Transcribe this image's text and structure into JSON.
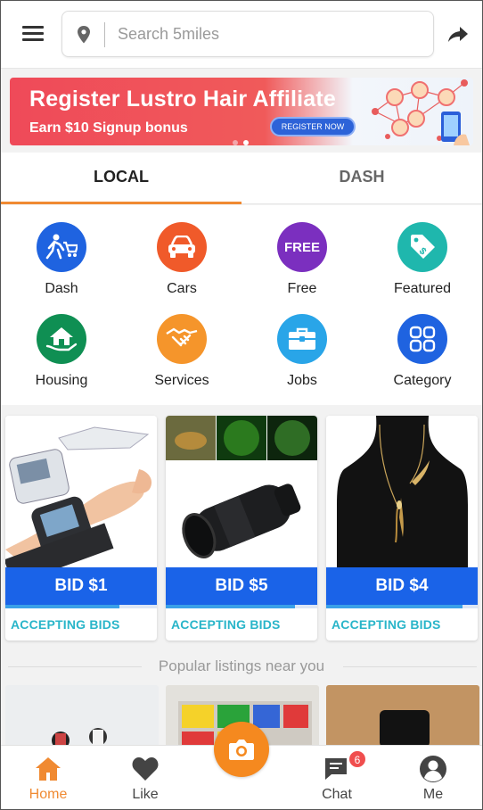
{
  "search": {
    "placeholder": "Search 5miles"
  },
  "banner": {
    "title": "Register Lustro Hair Affiliate",
    "subtitle": "Earn $10 Signup bonus",
    "button": "REGISTER NOW"
  },
  "tabs": [
    {
      "label": "LOCAL"
    },
    {
      "label": "DASH"
    }
  ],
  "categories": [
    {
      "label": "Dash",
      "icon": "dash-icon",
      "color": "#1f63e0"
    },
    {
      "label": "Cars",
      "icon": "car-icon",
      "color": "#f05a2a"
    },
    {
      "label": "Free",
      "icon": "free-icon",
      "color": "#7b2fbf",
      "badge": "FREE"
    },
    {
      "label": "Featured",
      "icon": "price-tag-icon",
      "color": "#1fb7ad"
    },
    {
      "label": "Housing",
      "icon": "house-icon",
      "color": "#0f8f53"
    },
    {
      "label": "Services",
      "icon": "handshake-icon",
      "color": "#f5952b"
    },
    {
      "label": "Jobs",
      "icon": "briefcase-icon",
      "color": "#29a5e8"
    },
    {
      "label": "Category",
      "icon": "grid-icon",
      "color": "#1f63e0"
    }
  ],
  "products": [
    {
      "bid": "BID $1",
      "status": "ACCEPTING BIDS",
      "progress": 0.75,
      "image": "blood-pressure-monitor"
    },
    {
      "bid": "BID $5",
      "status": "ACCEPTING BIDS",
      "progress": 0.85,
      "image": "monocular-scope"
    },
    {
      "bid": "BID $4",
      "status": "ACCEPTING BIDS",
      "progress": 0.9,
      "image": "feather-necklace"
    }
  ],
  "popular": {
    "heading": "Popular listings near you"
  },
  "nav": [
    {
      "label": "Home",
      "icon": "home-icon"
    },
    {
      "label": "Like",
      "icon": "heart-icon"
    },
    {
      "label": "",
      "icon": "camera-icon"
    },
    {
      "label": "Chat",
      "icon": "chat-icon",
      "badge": "6"
    },
    {
      "label": "Me",
      "icon": "profile-icon"
    }
  ],
  "colors": {
    "accent": "#f08a32",
    "bid": "#1a63e8",
    "accepting": "#29b5c9"
  }
}
